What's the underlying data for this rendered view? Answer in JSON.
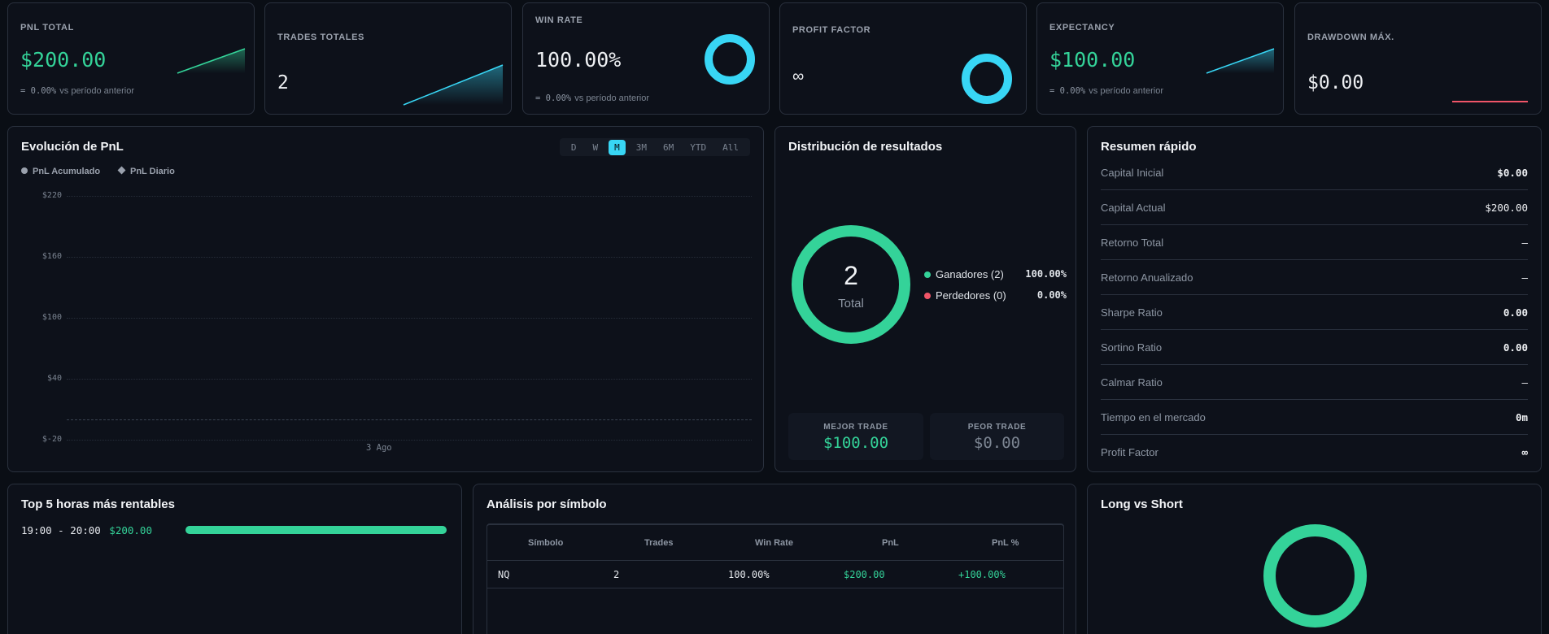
{
  "kpis": {
    "pnl_total": {
      "label": "PNL TOTAL",
      "value": "$200.00",
      "sub_pct": "= 0.00%",
      "sub_text": "vs período anterior"
    },
    "trades_totales": {
      "label": "TRADES TOTALES",
      "value": "2"
    },
    "win_rate": {
      "label": "WIN RATE",
      "value": "100.00%",
      "sub_pct": "= 0.00%",
      "sub_text": "vs período anterior",
      "gauge_fraction": 1.0
    },
    "profit_factor": {
      "label": "PROFIT FACTOR",
      "value": "∞",
      "gauge_fraction": 1.0
    },
    "expectancy": {
      "label": "EXPECTANCY",
      "value": "$100.00",
      "sub_pct": "= 0.00%",
      "sub_text": "vs período anterior"
    },
    "drawdown": {
      "label": "DRAWDOWN MÁX.",
      "value": "$0.00"
    }
  },
  "pnl_chart": {
    "title": "Evolución de PnL",
    "ranges": [
      "D",
      "W",
      "M",
      "3M",
      "6M",
      "YTD",
      "All"
    ],
    "active_range": "M",
    "legend": [
      "PnL Acumulado",
      "PnL Diario"
    ],
    "y_ticks": [
      "$220",
      "$160",
      "$100",
      "$40",
      "$-20"
    ],
    "x_tick": "3 Ago"
  },
  "distribution": {
    "title": "Distribución de resultados",
    "total_value": "2",
    "total_label": "Total",
    "legend": [
      {
        "label": "Ganadores (2)",
        "value": "100.00%",
        "color": "#34d399"
      },
      {
        "label": "Perdedores (0)",
        "value": "0.00%",
        "color": "#f05568"
      }
    ],
    "best": {
      "label": "MEJOR TRADE",
      "value": "$100.00"
    },
    "worst": {
      "label": "PEOR TRADE",
      "value": "$0.00"
    }
  },
  "quick_summary": {
    "title": "Resumen rápido",
    "rows": [
      {
        "label": "Capital Inicial",
        "value": "$0.00"
      },
      {
        "label": "Capital Actual",
        "value": "$200.00"
      },
      {
        "label": "Retorno Total",
        "value": "—"
      },
      {
        "label": "Retorno Anualizado",
        "value": "—"
      },
      {
        "label": "Sharpe Ratio",
        "value": "0.00"
      },
      {
        "label": "Sortino Ratio",
        "value": "0.00"
      },
      {
        "label": "Calmar Ratio",
        "value": "—"
      },
      {
        "label": "Tiempo en el mercado",
        "value": "0m"
      },
      {
        "label": "Profit Factor",
        "value": "∞"
      }
    ]
  },
  "top_hours": {
    "title": "Top 5 horas más rentables",
    "items": [
      {
        "range": "19:00 - 20:00",
        "value": "$200.00",
        "fraction": 1.0
      }
    ]
  },
  "symbol_analysis": {
    "title": "Análisis por símbolo",
    "headers": [
      "Símbolo",
      "Trades",
      "Win Rate",
      "PnL",
      "PnL %"
    ],
    "rows": [
      {
        "symbol": "NQ",
        "trades": "2",
        "win_rate": "100.00%",
        "pnl": "$200.00",
        "pnl_pct": "+100.00%"
      }
    ]
  },
  "long_short": {
    "title": "Long vs Short"
  },
  "colors": {
    "green": "#34d399",
    "cyan": "#38d6f5",
    "red": "#f05568",
    "card_bg": "#0d111a",
    "border": "#2a313e"
  }
}
